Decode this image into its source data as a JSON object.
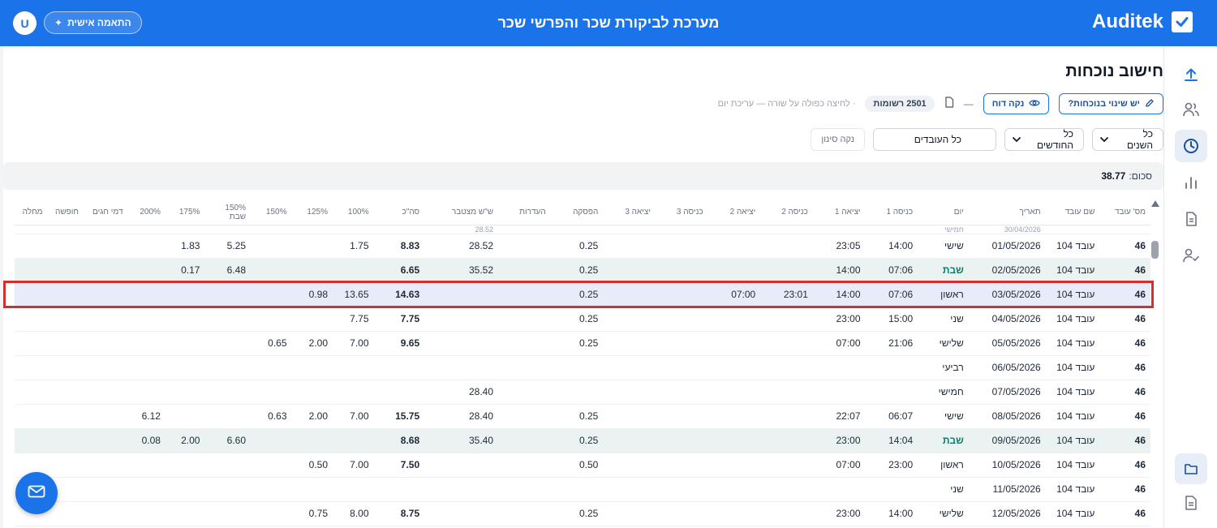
{
  "header": {
    "brand": "Auditek",
    "app_title": "מערכת לביקורת שכר והפרשי שכר",
    "personal_label": "התאמה אישית",
    "user_initial": "U"
  },
  "page": {
    "title": "חישוב נוכחות",
    "change_button": "יש שינוי בנוכחות?",
    "clean_report_button": "נקה דוח",
    "records_count": "2501 רשומות",
    "dash": "—",
    "hint": "· לחיצה כפולה על שורה — עריכת יום"
  },
  "filters": {
    "years": "כל השנים",
    "months": "כל החודשים",
    "employees": "כל העובדים",
    "clear": "נקה סינון"
  },
  "total": {
    "label": "סכום:",
    "value": "38.77"
  },
  "columns": [
    "מס' עובד",
    "שם עובד",
    "תאריך",
    "יום",
    "כניסה 1",
    "יציאה 1",
    "כניסה 2",
    "יציאה 2",
    "כניסה 3",
    "יציאה 3",
    "הפסקה",
    "העדרות",
    "ש\"ש מצטבר",
    "סה\"כ",
    "100%",
    "125%",
    "150%",
    "150% שבת",
    "175%",
    "200%",
    "דמי חגים",
    "חופשה",
    "מחלה"
  ],
  "partial_row": [
    "",
    "",
    "30/04/2026",
    "חמישי",
    "",
    "",
    "",
    "",
    "",
    "",
    "",
    "",
    "28.52",
    "",
    "",
    "",
    "",
    "",
    "",
    "",
    "",
    "",
    ""
  ],
  "rows": [
    {
      "cells": [
        "46",
        "עובד 104",
        "01/05/2026",
        "שישי",
        "14:00",
        "23:05",
        "",
        "",
        "",
        "",
        "0.25",
        "",
        "28.52",
        "8.83",
        "1.75",
        "",
        "",
        "5.25",
        "1.83",
        "",
        "",
        "",
        ""
      ],
      "type": "normal"
    },
    {
      "cells": [
        "46",
        "עובד 104",
        "02/05/2026",
        "שבת",
        "07:06",
        "14:00",
        "",
        "",
        "",
        "",
        "0.25",
        "",
        "35.52",
        "6.65",
        "",
        "",
        "",
        "6.48",
        "0.17",
        "",
        "",
        "",
        ""
      ],
      "type": "sat"
    },
    {
      "cells": [
        "46",
        "עובד 104",
        "03/05/2026",
        "ראשון",
        "07:06",
        "14:00",
        "23:01",
        "07:00",
        "",
        "",
        "0.25",
        "",
        "",
        "14.63",
        "13.65",
        "0.98",
        "",
        "",
        "",
        "",
        "",
        "",
        ""
      ],
      "type": "sel"
    },
    {
      "cells": [
        "46",
        "עובד 104",
        "04/05/2026",
        "שני",
        "15:00",
        "23:00",
        "",
        "",
        "",
        "",
        "0.25",
        "",
        "",
        "7.75",
        "7.75",
        "",
        "",
        "",
        "",
        "",
        "",
        "",
        ""
      ],
      "type": "normal"
    },
    {
      "cells": [
        "46",
        "עובד 104",
        "05/05/2026",
        "שלישי",
        "21:06",
        "07:00",
        "",
        "",
        "",
        "",
        "0.25",
        "",
        "",
        "9.65",
        "7.00",
        "2.00",
        "0.65",
        "",
        "",
        "",
        "",
        "",
        ""
      ],
      "type": "normal"
    },
    {
      "cells": [
        "46",
        "עובד 104",
        "06/05/2026",
        "רביעי",
        "",
        "",
        "",
        "",
        "",
        "",
        "",
        "",
        "",
        "",
        "",
        "",
        "",
        "",
        "",
        "",
        "",
        "",
        ""
      ],
      "type": "normal"
    },
    {
      "cells": [
        "46",
        "עובד 104",
        "07/05/2026",
        "חמישי",
        "",
        "",
        "",
        "",
        "",
        "",
        "",
        "",
        "28.40",
        "",
        "",
        "",
        "",
        "",
        "",
        "",
        "",
        "",
        ""
      ],
      "type": "normal"
    },
    {
      "cells": [
        "46",
        "עובד 104",
        "08/05/2026",
        "שישי",
        "06:07",
        "22:07",
        "",
        "",
        "",
        "",
        "0.25",
        "",
        "28.40",
        "15.75",
        "7.00",
        "2.00",
        "0.63",
        "",
        "",
        "6.12",
        "",
        "",
        ""
      ],
      "type": "normal"
    },
    {
      "cells": [
        "46",
        "עובד 104",
        "09/05/2026",
        "שבת",
        "14:04",
        "23:00",
        "",
        "",
        "",
        "",
        "0.25",
        "",
        "35.40",
        "8.68",
        "",
        "",
        "",
        "6.60",
        "2.00",
        "0.08",
        "",
        "",
        ""
      ],
      "type": "sat"
    },
    {
      "cells": [
        "46",
        "עובד 104",
        "10/05/2026",
        "ראשון",
        "23:00",
        "07:00",
        "",
        "",
        "",
        "",
        "0.50",
        "",
        "",
        "7.50",
        "7.00",
        "0.50",
        "",
        "",
        "",
        "",
        "",
        "",
        ""
      ],
      "type": "normal"
    },
    {
      "cells": [
        "46",
        "עובד 104",
        "11/05/2026",
        "שני",
        "",
        "",
        "",
        "",
        "",
        "",
        "",
        "",
        "",
        "",
        "",
        "",
        "",
        "",
        "",
        "",
        "",
        "",
        ""
      ],
      "type": "normal"
    },
    {
      "cells": [
        "46",
        "עובד 104",
        "12/05/2026",
        "שלישי",
        "14:00",
        "23:00",
        "",
        "",
        "",
        "",
        "0.25",
        "",
        "",
        "8.75",
        "8.00",
        "0.75",
        "",
        "",
        "",
        "",
        "",
        "",
        ""
      ],
      "type": "normal"
    }
  ]
}
